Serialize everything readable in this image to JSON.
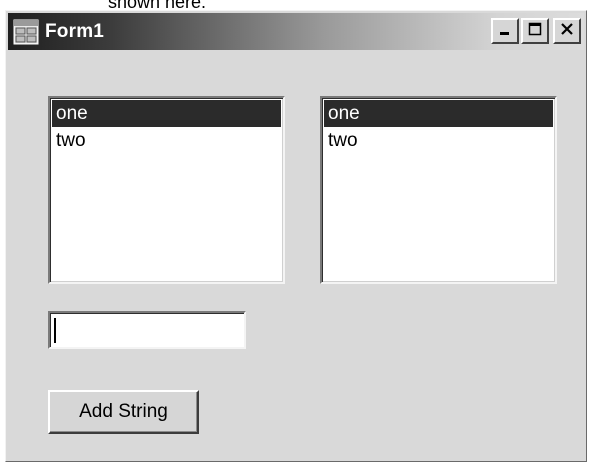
{
  "caption_fragment": "shown here.",
  "window": {
    "title": "Form1",
    "icons": {
      "app": "form-icon",
      "minimize": "minimize-icon",
      "maximize": "maximize-icon",
      "close": "close-icon"
    }
  },
  "listbox_left": {
    "items": [
      "one",
      "two"
    ],
    "selected_index": 0
  },
  "listbox_right": {
    "items": [
      "one",
      "two"
    ],
    "selected_index": 0
  },
  "textbox": {
    "value": ""
  },
  "add_button": {
    "label": "Add String"
  },
  "colors": {
    "form_background": "#d9d9d9",
    "selection": "#2b2b2b"
  }
}
